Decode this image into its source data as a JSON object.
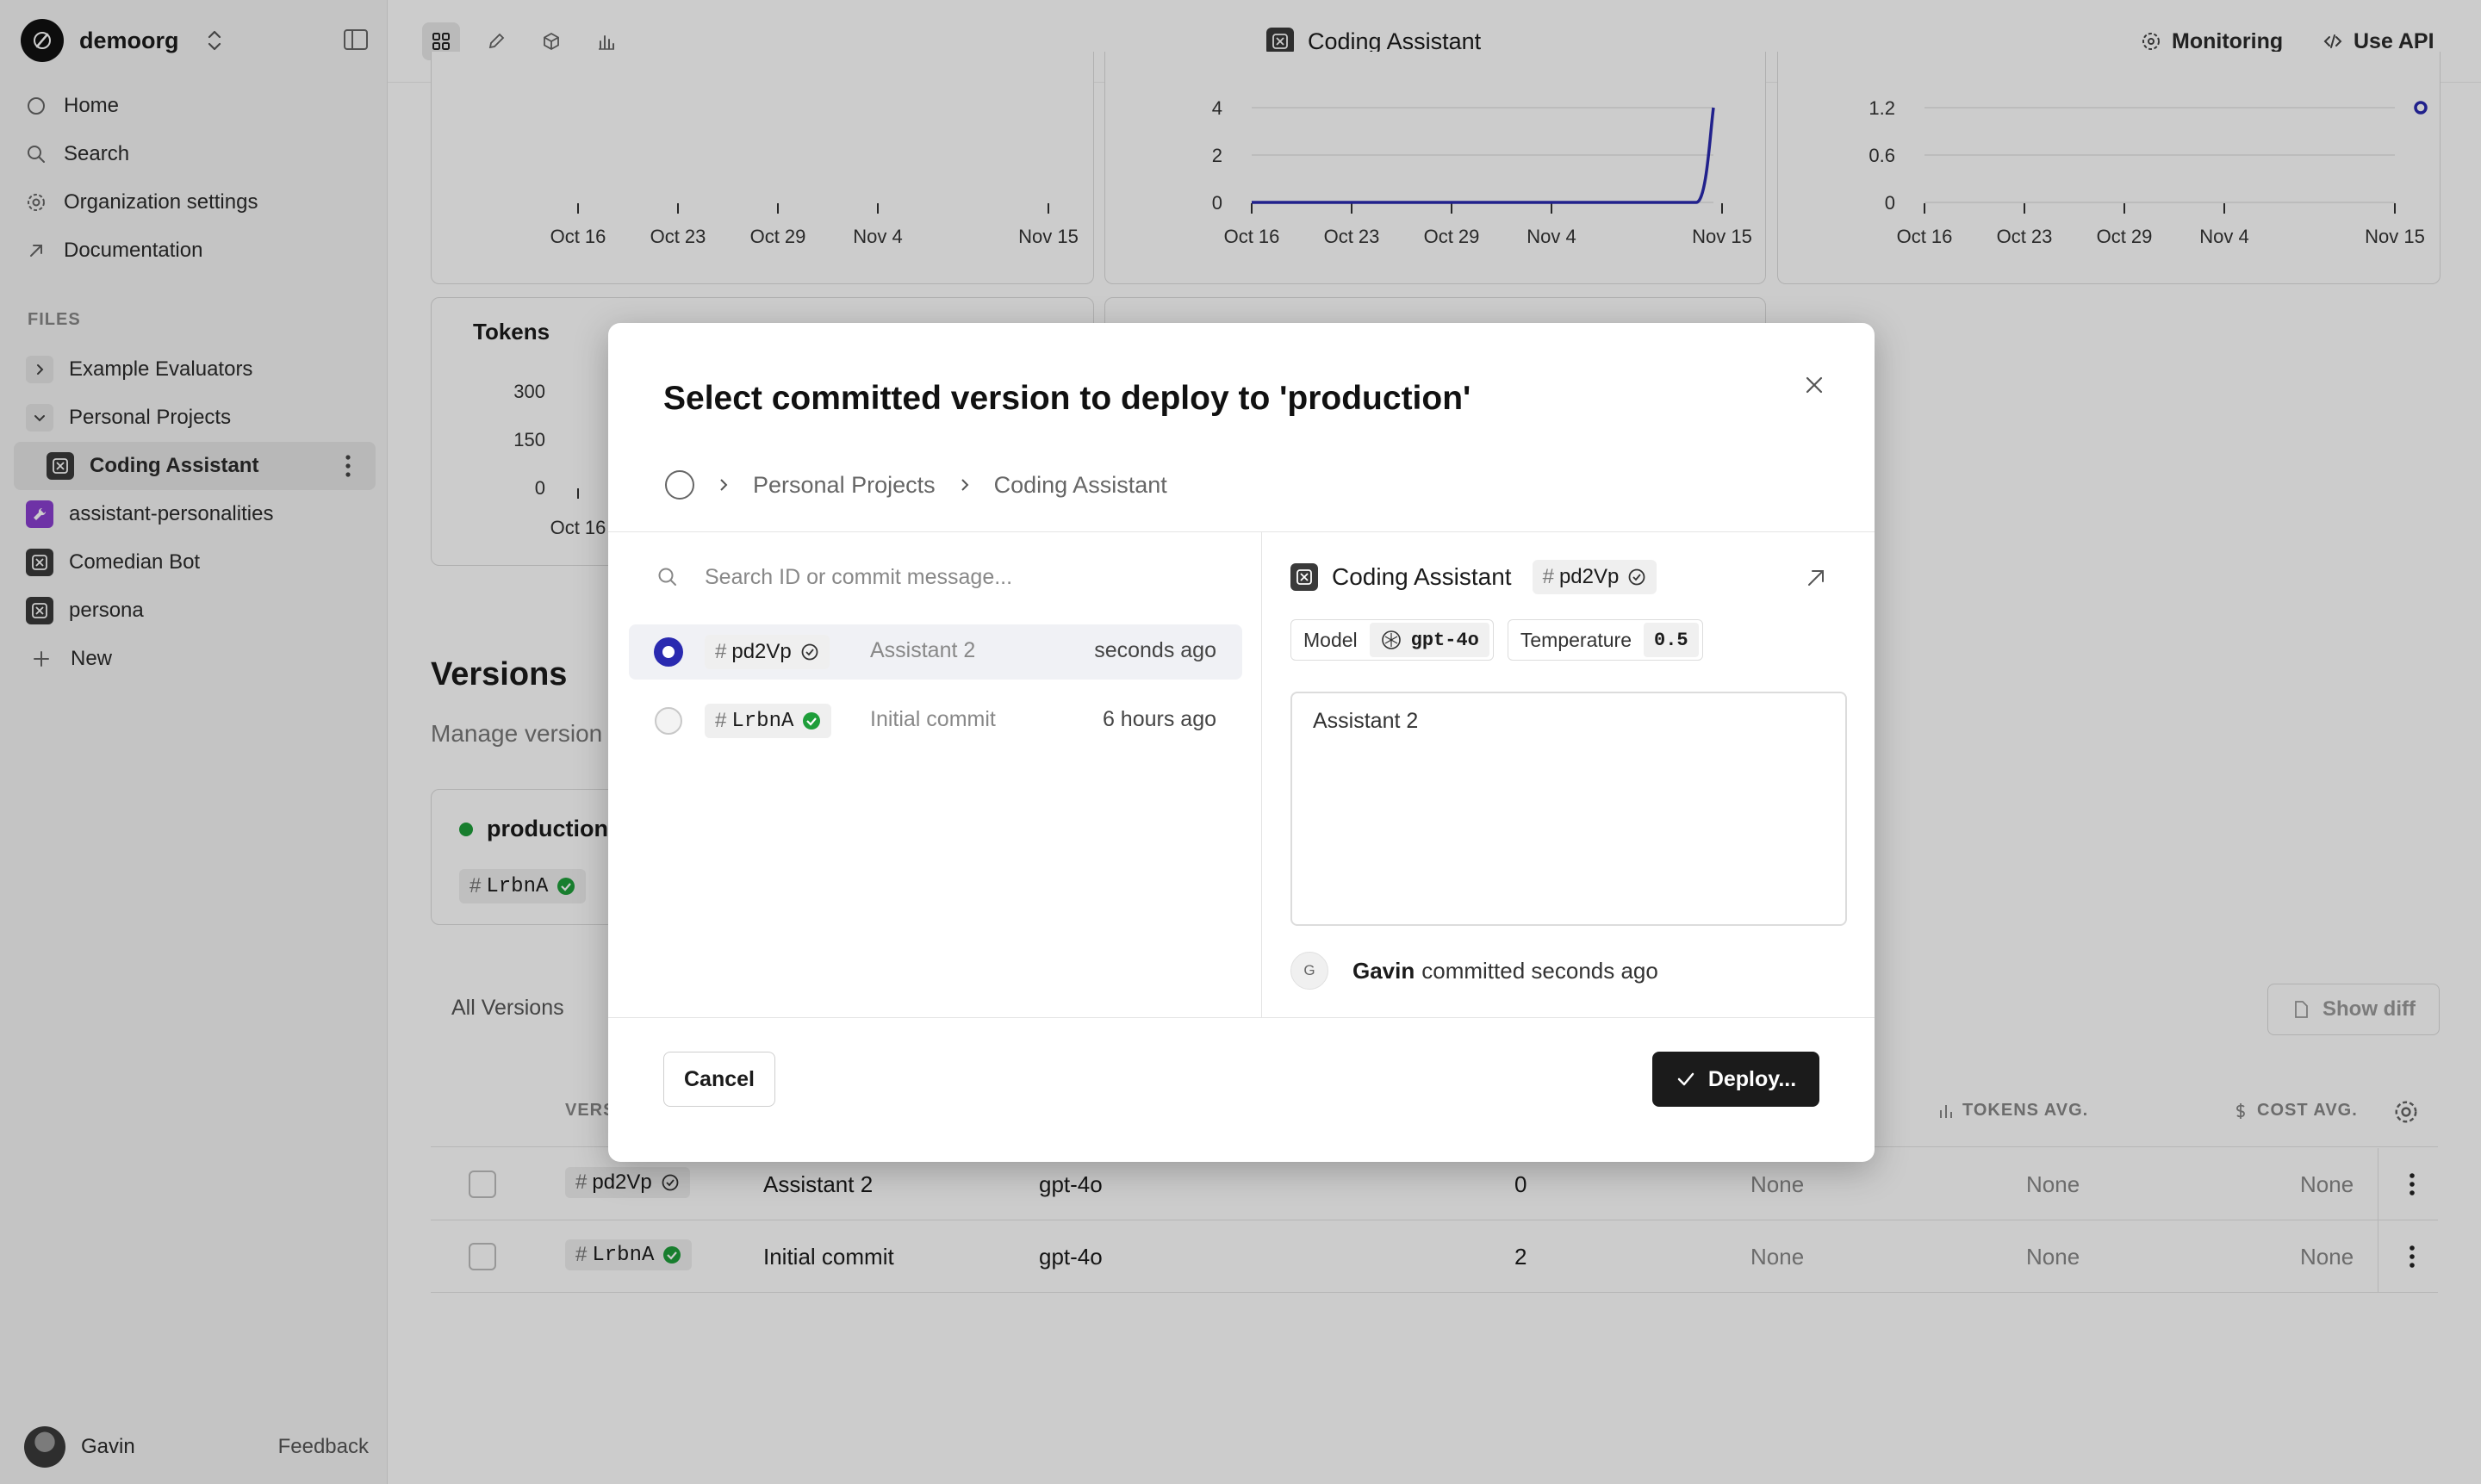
{
  "sidebar": {
    "org_name": "demoorg",
    "nav": [
      {
        "label": "Home",
        "icon": "circle-icon"
      },
      {
        "label": "Search",
        "icon": "search-icon"
      },
      {
        "label": "Organization settings",
        "icon": "gear-icon"
      },
      {
        "label": "Documentation",
        "icon": "arrow-up-right-icon"
      }
    ],
    "files_label": "FILES",
    "tree": [
      {
        "label": "Example Evaluators",
        "type": "folder",
        "expanded": false
      },
      {
        "label": "Personal Projects",
        "type": "folder",
        "expanded": true
      },
      {
        "label": "Coding Assistant",
        "type": "prompt",
        "active": true
      },
      {
        "label": "assistant-personalities",
        "type": "tool"
      },
      {
        "label": "Comedian Bot",
        "type": "prompt"
      },
      {
        "label": "persona",
        "type": "prompt"
      },
      {
        "label": "New",
        "type": "new"
      }
    ],
    "user_name": "Gavin",
    "feedback_label": "Feedback"
  },
  "topbar": {
    "title": "Coding Assistant",
    "monitoring_label": "Monitoring",
    "api_label": "Use API"
  },
  "charts": {
    "x_ticks": [
      "Oct 16",
      "Oct 23",
      "Oct 29",
      "Nov 4",
      "Nov 15"
    ],
    "tokens_title": "Tokens",
    "colors": {
      "line": "#2a2ab0"
    }
  },
  "chart_data": [
    {
      "type": "line",
      "x": [
        "Oct 16",
        "Oct 23",
        "Oct 29",
        "Nov 4",
        "Nov 15"
      ],
      "y_ticks": [
        0,
        2,
        4
      ],
      "series": [
        {
          "values": [
            0,
            0,
            0,
            0,
            4
          ]
        }
      ]
    },
    {
      "type": "scatter",
      "x": [
        "Oct 16",
        "Oct 23",
        "Oct 29",
        "Nov 4",
        "Nov 15"
      ],
      "y_ticks": [
        0,
        0.6,
        1.2
      ],
      "series": [
        {
          "points": [
            [
              "Nov 15",
              1.2
            ]
          ]
        }
      ]
    },
    {
      "type": "line",
      "title": "Tokens",
      "x": [
        "Oct 16"
      ],
      "y_ticks": [
        0,
        150,
        300
      ]
    }
  ],
  "versions": {
    "title": "Versions",
    "subtitle": "Manage version",
    "production": {
      "label": "production",
      "hash": "LrbnA"
    },
    "tabs": [
      "All Versions"
    ],
    "show_diff_label": "Show diff",
    "columns": {
      "version": "VERS",
      "tokens_avg": "TOKENS AVG.",
      "cost_avg": "COST AVG."
    },
    "rows": [
      {
        "hash": "pd2Vp",
        "message": "Assistant 2",
        "model": "gpt-4o",
        "count": "0",
        "c1": "None",
        "c2": "None",
        "c3": "None",
        "status": "committed"
      },
      {
        "hash": "LrbnA",
        "message": "Initial commit",
        "model": "gpt-4o",
        "count": "2",
        "c1": "None",
        "c2": "None",
        "c3": "None",
        "status": "deployed"
      }
    ]
  },
  "modal": {
    "title": "Select committed version to deploy to 'production'",
    "breadcrumb": [
      "Personal Projects",
      "Coding Assistant"
    ],
    "search_placeholder": "Search ID or commit message...",
    "versions": [
      {
        "hash": "pd2Vp",
        "message": "Assistant 2",
        "time": "seconds ago",
        "selected": true
      },
      {
        "hash": "LrbnA",
        "message": "Initial commit",
        "time": "6 hours ago",
        "selected": false
      }
    ],
    "detail": {
      "name": "Coding Assistant",
      "hash": "pd2Vp",
      "model_label": "Model",
      "model_value": "gpt-4o",
      "temperature_label": "Temperature",
      "temperature_value": "0.5",
      "prompt_text": "Assistant 2",
      "committer_initial": "G",
      "committer_name": "Gavin",
      "committed_text": "committed seconds ago"
    },
    "cancel_label": "Cancel",
    "deploy_label": "Deploy..."
  }
}
